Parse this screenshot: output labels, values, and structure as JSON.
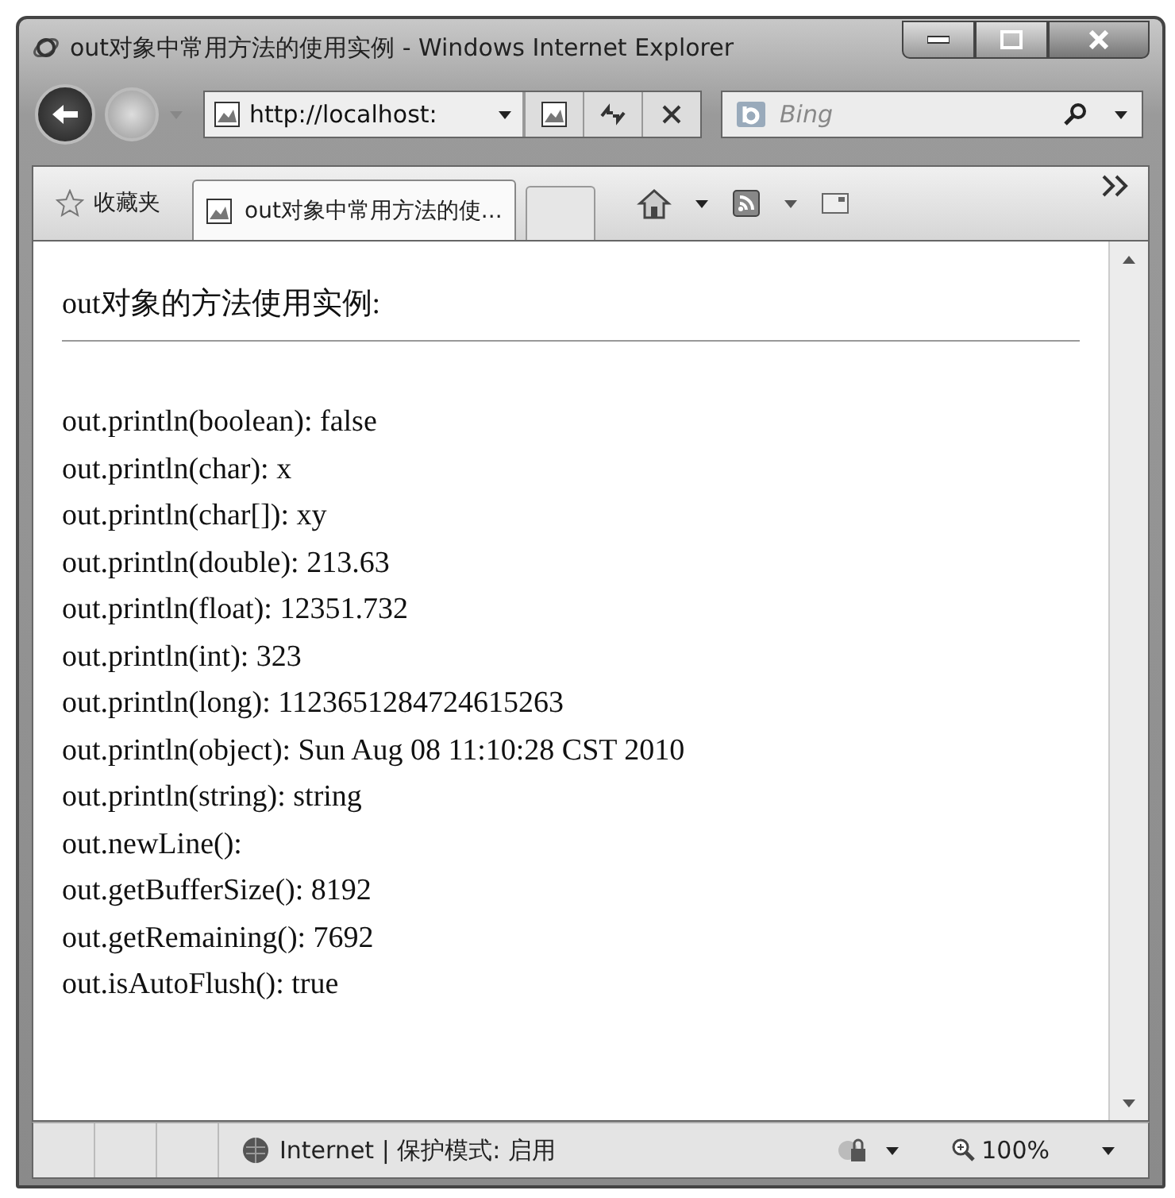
{
  "window": {
    "title": "out对象中常用方法的使用实例 - Windows Internet Explorer"
  },
  "address_bar": {
    "value": "http://localhost:"
  },
  "search": {
    "placeholder": "Bing"
  },
  "favorites": {
    "label": "收藏夹"
  },
  "tabs": [
    {
      "label": "out对象中常用方法的使...",
      "selected": true
    }
  ],
  "page": {
    "heading": "out对象的方法使用实例:",
    "lines": [
      "out.println(boolean): false",
      "out.println(char): x",
      "out.println(char[]): xy",
      "out.println(double): 213.63",
      "out.println(float): 12351.732",
      "out.println(int): 323",
      "out.println(long): 1123651284724615263",
      "out.println(object): Sun Aug 08 11:10:28 CST 2010",
      "out.println(string): string",
      "out.newLine():",
      "out.getBufferSize(): 8192",
      "out.getRemaining(): 7692",
      "out.isAutoFlush(): true"
    ]
  },
  "status_bar": {
    "zone": "Internet | 保护模式: 启用",
    "zoom": "100%"
  }
}
